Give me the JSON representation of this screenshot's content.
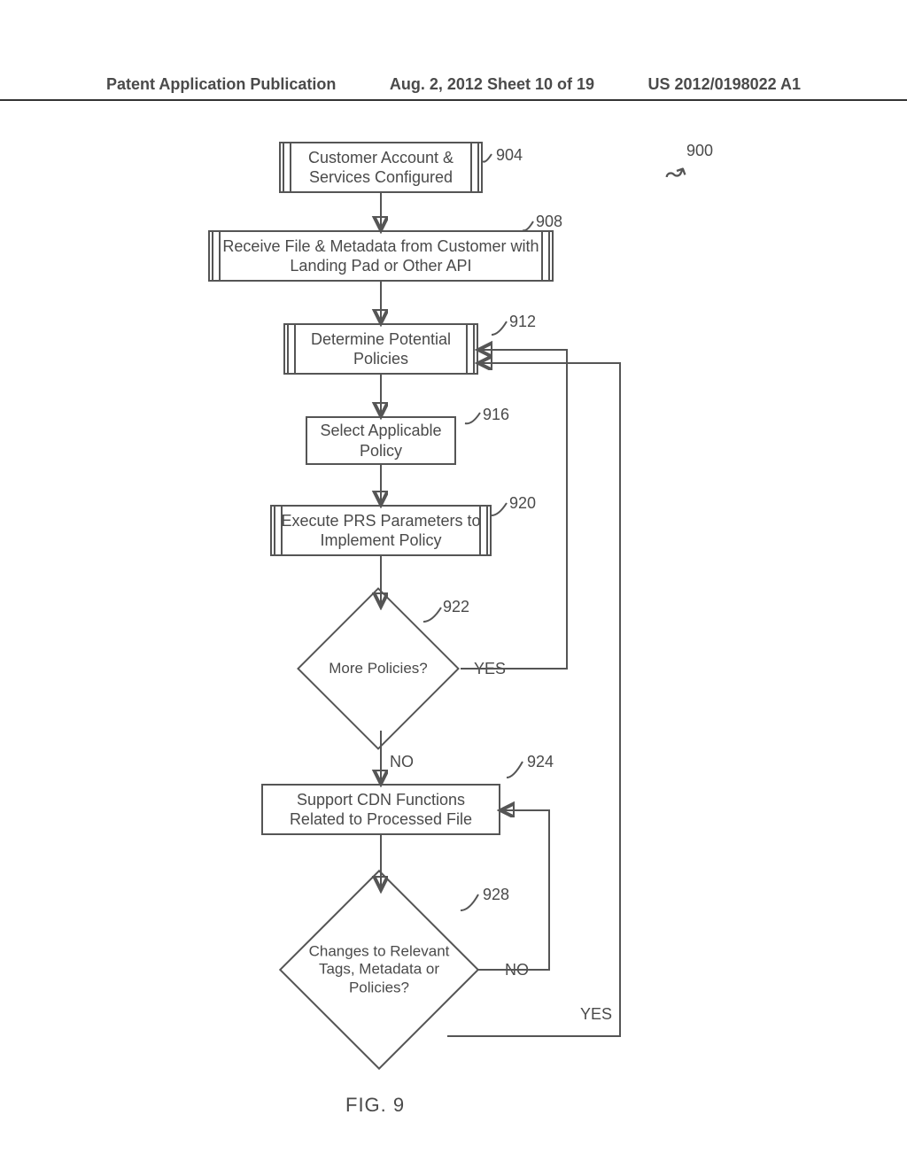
{
  "header": {
    "left": "Patent Application Publication",
    "center": "Aug. 2, 2012  Sheet 10 of 19",
    "right": "US 2012/0198022 A1"
  },
  "refs": {
    "r900": "900",
    "r904": "904",
    "r908": "908",
    "r912": "912",
    "r916": "916",
    "r920": "920",
    "r922": "922",
    "r924": "924",
    "r928": "928"
  },
  "nodes": {
    "n904": "Customer Account & Services Configured",
    "n908": "Receive File & Metadata from Customer with Landing Pad or Other API",
    "n912": "Determine Potential Policies",
    "n916": "Select Applicable Policy",
    "n920": "Execute PRS Parameters to Implement Policy",
    "n922": "More Policies?",
    "n924": "Support CDN Functions Related to Processed File",
    "n928": "Changes to Relevant Tags, Metadata or Policies?"
  },
  "responses": {
    "yes": "YES",
    "no": "NO"
  },
  "figure_label": "FIG. 9",
  "chart_data": {
    "type": "flowchart",
    "title": "FIG. 9",
    "nodes": [
      {
        "id": "904",
        "kind": "process",
        "text": "Customer Account & Services Configured"
      },
      {
        "id": "908",
        "kind": "process",
        "text": "Receive File & Metadata from Customer with Landing Pad or Other API"
      },
      {
        "id": "912",
        "kind": "process",
        "text": "Determine Potential Policies"
      },
      {
        "id": "916",
        "kind": "process-plain",
        "text": "Select Applicable Policy"
      },
      {
        "id": "920",
        "kind": "process",
        "text": "Execute PRS Parameters to Implement Policy"
      },
      {
        "id": "922",
        "kind": "decision",
        "text": "More Policies?"
      },
      {
        "id": "924",
        "kind": "process-plain",
        "text": "Support CDN Functions Related to Processed File"
      },
      {
        "id": "928",
        "kind": "decision",
        "text": "Changes to Relevant Tags, Metadata or Policies?"
      }
    ],
    "edges": [
      {
        "from": "904",
        "to": "908"
      },
      {
        "from": "908",
        "to": "912"
      },
      {
        "from": "912",
        "to": "916"
      },
      {
        "from": "916",
        "to": "920"
      },
      {
        "from": "920",
        "to": "922"
      },
      {
        "from": "922",
        "to": "912",
        "label": "YES"
      },
      {
        "from": "922",
        "to": "924",
        "label": "NO"
      },
      {
        "from": "924",
        "to": "928"
      },
      {
        "from": "928",
        "to": "924",
        "label": "NO"
      },
      {
        "from": "928",
        "to": "912",
        "label": "YES"
      }
    ],
    "figure_reference_number": "900"
  }
}
